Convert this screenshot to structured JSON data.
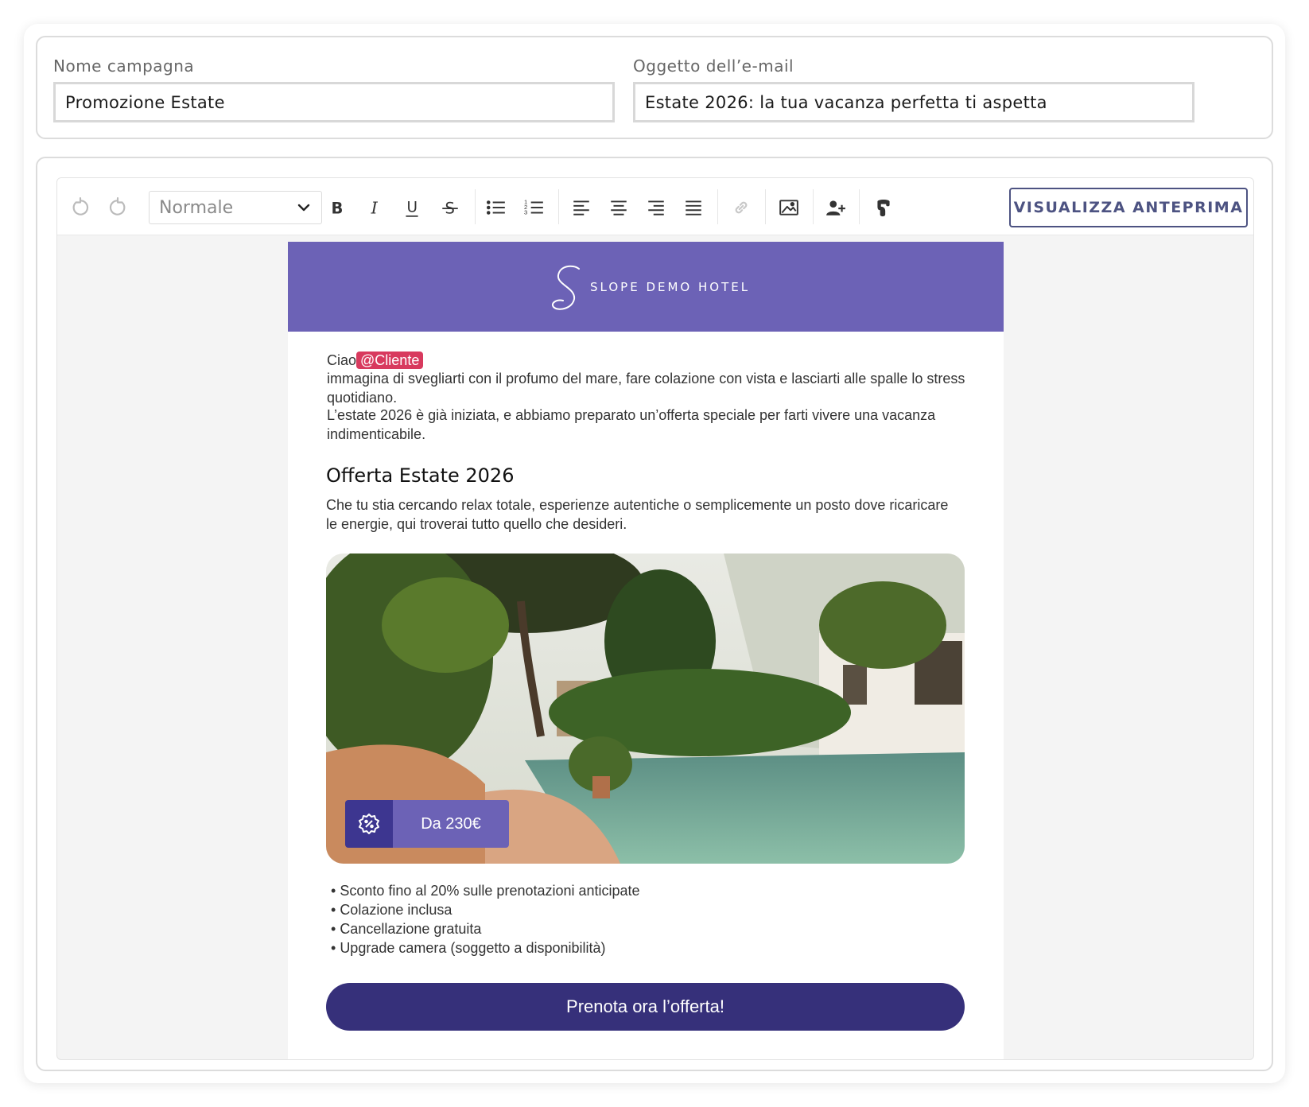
{
  "campaign_form": {
    "name_label": "Nome campagna",
    "name_value": "Promozione Estate",
    "subject_label": "Oggetto dell’e-mail",
    "subject_value": "Estate 2026: la tua vacanza perfetta ti aspetta"
  },
  "toolbar": {
    "style_select_value": "Normale",
    "preview_button": "VISUALIZZA ANTEPRIMA",
    "icons": [
      "undo-icon",
      "redo-icon",
      "bold-icon",
      "italic-icon",
      "underline-icon",
      "strikethrough-icon",
      "bullet-list-icon",
      "numbered-list-icon",
      "align-left-icon",
      "align-center-icon",
      "align-right-icon",
      "align-justify-icon",
      "link-icon",
      "image-icon",
      "add-user-icon",
      "merge-tag-icon"
    ]
  },
  "email": {
    "header_brand": "SLOPE DEMO HOTEL",
    "greeting": "Ciao",
    "mention": "@Cliente",
    "paragraph1": "immagina di svegliarti con il profumo del mare, fare colazione con vista e lasciarti alle spalle lo stress quotidiano.",
    "paragraph2": "L’estate 2026 è già iniziata, e abbiamo preparato un’offerta speciale per farti vivere una vacanza indimenticabile.",
    "offer_title": "Offerta Estate 2026",
    "offer_description": "Che tu stia cercando relax totale, esperienze autentiche o semplicemente un posto dove ricaricare le energie, qui troverai tutto quello che desideri.",
    "price_badge": "Da 230€",
    "bullets": [
      "Sconto fino al 20% sulle prenotazioni anticipate",
      "Colazione inclusa",
      "Cancellazione gratuita",
      "Upgrade camera (soggetto a disponibilità)"
    ],
    "cta_button": "Prenota ora l’offerta!"
  },
  "colors": {
    "header_purple": "#6c62b6",
    "cta_dark": "#36307a",
    "mention_red": "#d83a5e",
    "preview_border": "#4d5382"
  }
}
